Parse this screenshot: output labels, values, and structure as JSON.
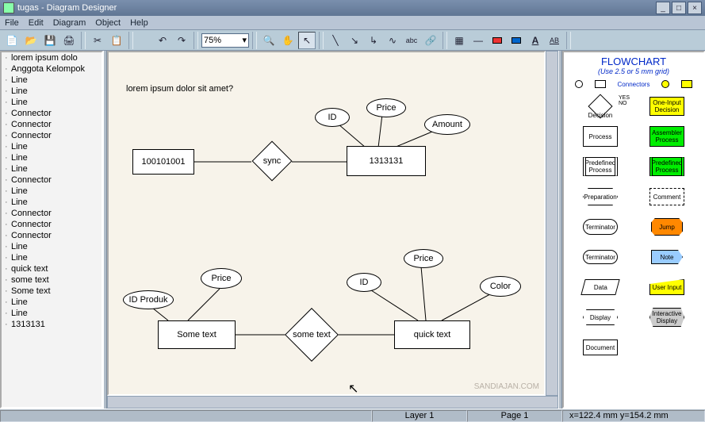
{
  "window": {
    "title": "tugas - Diagram Designer"
  },
  "menu": {
    "file": "File",
    "edit": "Edit",
    "diagram": "Diagram",
    "object": "Object",
    "help": "Help"
  },
  "toolbar": {
    "zoom": "75%"
  },
  "tree": {
    "items": [
      "lorem ipsum dolo",
      "Anggota Kelompok",
      "Line",
      "Line",
      "Line",
      "Connector",
      "Connector",
      "Connector",
      "Line",
      "Line",
      "Line",
      "Connector",
      "Line",
      "Line",
      "Connector",
      "Connector",
      "Connector",
      "Line",
      "Line",
      "quick text",
      "some text",
      "Some text",
      "Line",
      "Line",
      "1313131"
    ]
  },
  "canvas": {
    "caption": "lorem ipsum dolor sit amet?",
    "nodes": {
      "rect1": "100101001",
      "diamond1": "sync",
      "rect2": "1313131",
      "ell_id1": "ID",
      "ell_price1": "Price",
      "ell_amount": "Amount",
      "ell_idproduk": "ID Produk",
      "ell_price2": "Price",
      "rect3": "Some text",
      "diamond2": "some text",
      "rect4": "quick text",
      "ell_id2": "ID",
      "ell_price3": "Price",
      "ell_color": "Color"
    }
  },
  "palette": {
    "title": "FLOWCHART",
    "subtitle": "(Use 2.5 or 5 mm grid)",
    "connectors_label": "Connectors",
    "decision": "Decision",
    "yes": "YES",
    "no": "NO",
    "oneinput": "One-Input Decision",
    "process": "Process",
    "assembler": "Assembler Process",
    "predefined": "Predefined Process",
    "predefined2": "Predefined Process",
    "preparation": "Preparation",
    "comment": "Comment",
    "terminator": "Terminator",
    "jump": "Jump",
    "terminator2": "Terminator",
    "note": "Note",
    "data": "Data",
    "userinput": "User Input",
    "display": "Display",
    "interactive": "Interactive Display",
    "document": "Document"
  },
  "status": {
    "layer": "Layer 1",
    "page": "Page 1",
    "coords": "x=122.4 mm  y=154.2 mm"
  },
  "watermark": "SANDIAJAN.COM"
}
